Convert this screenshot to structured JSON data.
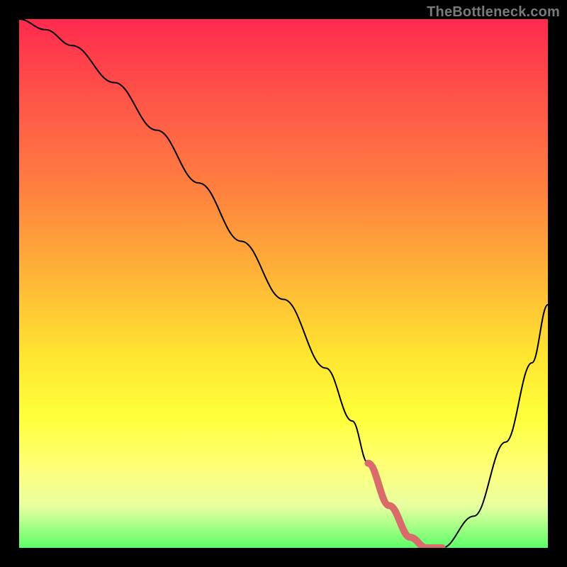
{
  "watermark": "TheBottleneck.com",
  "chart_data": {
    "type": "line",
    "title": "",
    "xlabel": "",
    "ylabel": "",
    "xlim": [
      0,
      100
    ],
    "ylim": [
      0,
      100
    ],
    "series": [
      {
        "name": "bottleneck-curve",
        "x": [
          0,
          5,
          10,
          18,
          26,
          34,
          42,
          50,
          58,
          63,
          66,
          70,
          74,
          77,
          80,
          86,
          92,
          97,
          100
        ],
        "values": [
          100,
          98,
          95,
          88,
          79,
          69,
          58,
          47,
          34,
          24,
          16,
          8,
          2,
          0,
          0,
          6,
          20,
          35,
          46
        ]
      }
    ],
    "highlight_segment": {
      "name": "trough-highlight",
      "x": [
        66,
        70,
        74,
        77,
        80
      ],
      "values": [
        16,
        8,
        2,
        0,
        0
      ]
    }
  }
}
